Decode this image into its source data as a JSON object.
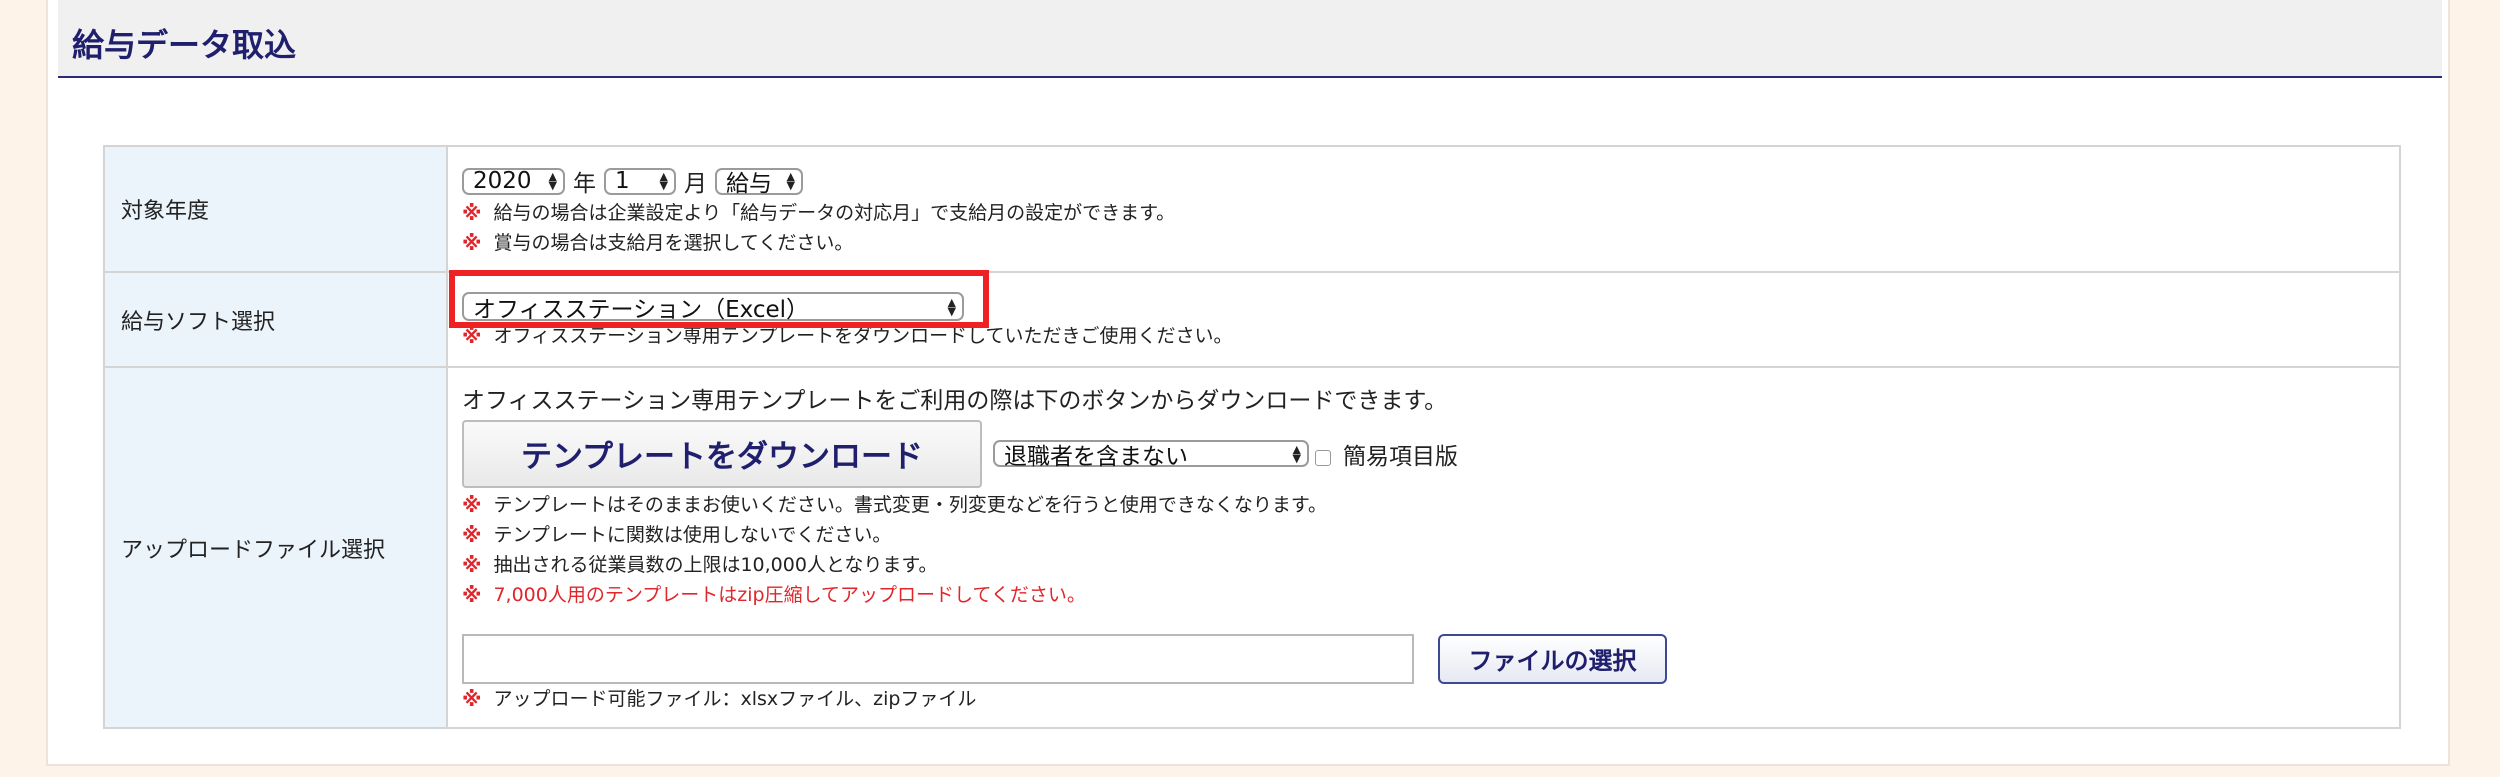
{
  "header": {
    "title": "給与データ取込"
  },
  "target_year": {
    "label": "対象年度",
    "year": "2020",
    "year_unit": "年",
    "month": "1",
    "month_unit": "月",
    "type": "給与",
    "notes": [
      "給与の場合は企業設定より「給与データの対応月」で支給月の設定ができます。",
      "賞与の場合は支給月を選択してください。"
    ]
  },
  "software": {
    "label": "給与ソフト選択",
    "selected": "オフィスステーション（Excel）",
    "note": "オフィスステーション専用テンプレートをダウンロードしていただきご使用ください。"
  },
  "upload": {
    "label": "アップロードファイル選択",
    "intro": "オフィスステーション専用テンプレートをご利用の際は下のボタンからダウンロードできます。",
    "download_button": "テンプレートをダウンロード",
    "retired_select": "退職者を含まない",
    "simple_label": "簡易項目版",
    "notes": [
      "テンプレートはそのままお使いください。書式変更・列変更などを行うと使用できなくなります。",
      "テンプレートに関数は使用しないでください。",
      "抽出される従業員数の上限は10,000人となります。"
    ],
    "warning": "7,000人用のテンプレートはzip圧縮してアップロードしてください。",
    "file_button": "ファイルの選択",
    "file_note": "アップロード可能ファイル：xlsxファイル、zipファイル",
    "note_mark": "※"
  },
  "colors": {
    "accent": "#1f1f6e",
    "warning": "#e0262b",
    "highlight": "#ee2222"
  }
}
